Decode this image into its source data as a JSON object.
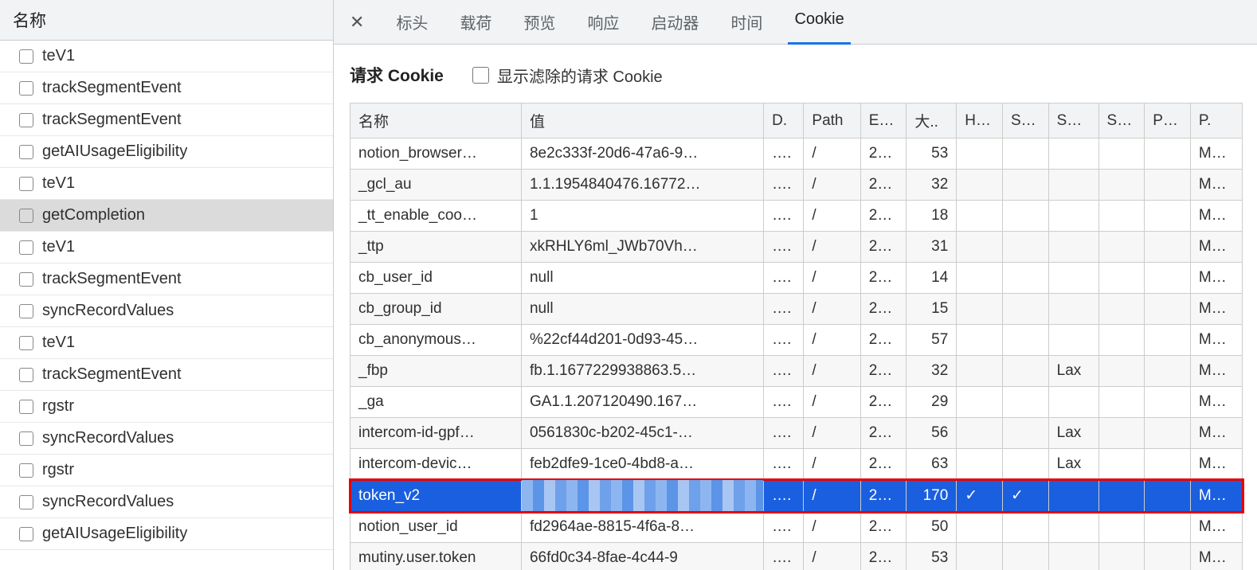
{
  "left": {
    "header": "名称",
    "items": [
      "teV1",
      "trackSegmentEvent",
      "trackSegmentEvent",
      "getAIUsageEligibility",
      "teV1",
      "getCompletion",
      "teV1",
      "trackSegmentEvent",
      "syncRecordValues",
      "teV1",
      "trackSegmentEvent",
      "rgstr",
      "syncRecordValues",
      "rgstr",
      "syncRecordValues",
      "getAIUsageEligibility"
    ],
    "selected_index": 5
  },
  "tabs": {
    "labels": [
      "标头",
      "载荷",
      "预览",
      "响应",
      "启动器",
      "时间",
      "Cookie"
    ],
    "active_index": 6
  },
  "section": {
    "title": "请求 Cookie",
    "filter_label": "显示滤除的请求 Cookie"
  },
  "cookie_headers": [
    "名称",
    "值",
    "D.",
    "Path",
    "E…",
    "大..",
    "H…",
    "S…",
    "S…",
    "S…",
    "P…",
    "P."
  ],
  "cookies": [
    {
      "name": "notion_browser…",
      "value": "8e2c333f-20d6-47a6-9…",
      "d": "….",
      "path": "/",
      "e": "2…",
      "size": "53",
      "h": "",
      "s1": "",
      "s2": "",
      "s3": "",
      "p1": "",
      "p2": "M…"
    },
    {
      "name": "_gcl_au",
      "value": "1.1.1954840476.16772…",
      "d": "….",
      "path": "/",
      "e": "2…",
      "size": "32",
      "h": "",
      "s1": "",
      "s2": "",
      "s3": "",
      "p1": "",
      "p2": "M…"
    },
    {
      "name": "_tt_enable_coo…",
      "value": "1",
      "d": "….",
      "path": "/",
      "e": "2…",
      "size": "18",
      "h": "",
      "s1": "",
      "s2": "",
      "s3": "",
      "p1": "",
      "p2": "M…"
    },
    {
      "name": "_ttp",
      "value": "xkRHLY6ml_JWb70Vh…",
      "d": "….",
      "path": "/",
      "e": "2…",
      "size": "31",
      "h": "",
      "s1": "",
      "s2": "",
      "s3": "",
      "p1": "",
      "p2": "M…"
    },
    {
      "name": "cb_user_id",
      "value": "null",
      "d": "….",
      "path": "/",
      "e": "2…",
      "size": "14",
      "h": "",
      "s1": "",
      "s2": "",
      "s3": "",
      "p1": "",
      "p2": "M…"
    },
    {
      "name": "cb_group_id",
      "value": "null",
      "d": "….",
      "path": "/",
      "e": "2…",
      "size": "15",
      "h": "",
      "s1": "",
      "s2": "",
      "s3": "",
      "p1": "",
      "p2": "M…"
    },
    {
      "name": "cb_anonymous…",
      "value": "%22cf44d201-0d93-45…",
      "d": "….",
      "path": "/",
      "e": "2…",
      "size": "57",
      "h": "",
      "s1": "",
      "s2": "",
      "s3": "",
      "p1": "",
      "p2": "M…"
    },
    {
      "name": "_fbp",
      "value": "fb.1.1677229938863.5…",
      "d": "….",
      "path": "/",
      "e": "2…",
      "size": "32",
      "h": "",
      "s1": "",
      "s2": "Lax",
      "s3": "",
      "p1": "",
      "p2": "M…"
    },
    {
      "name": "_ga",
      "value": "GA1.1.207120490.167…",
      "d": "….",
      "path": "/",
      "e": "2…",
      "size": "29",
      "h": "",
      "s1": "",
      "s2": "",
      "s3": "",
      "p1": "",
      "p2": "M…"
    },
    {
      "name": "intercom-id-gpf…",
      "value": "0561830c-b202-45c1-…",
      "d": "….",
      "path": "/",
      "e": "2…",
      "size": "56",
      "h": "",
      "s1": "",
      "s2": "Lax",
      "s3": "",
      "p1": "",
      "p2": "M…"
    },
    {
      "name": "intercom-devic…",
      "value": "feb2dfe9-1ce0-4bd8-a…",
      "d": "….",
      "path": "/",
      "e": "2…",
      "size": "63",
      "h": "",
      "s1": "",
      "s2": "Lax",
      "s3": "",
      "p1": "",
      "p2": "M…"
    },
    {
      "name": "token_v2",
      "value": "",
      "d": "….",
      "path": "/",
      "e": "2…",
      "size": "170",
      "h": "✓",
      "s1": "✓",
      "s2": "",
      "s3": "",
      "p1": "",
      "p2": "M…",
      "selected": true,
      "outline": true,
      "pixelate_value": true
    },
    {
      "name": "notion_user_id",
      "value": "fd2964ae-8815-4f6a-8…",
      "d": "….",
      "path": "/",
      "e": "2…",
      "size": "50",
      "h": "",
      "s1": "",
      "s2": "",
      "s3": "",
      "p1": "",
      "p2": "M…"
    },
    {
      "name": "mutiny.user.token",
      "value": "66fd0c34-8fae-4c44-9",
      "d": "….",
      "path": "/",
      "e": "2…",
      "size": "53",
      "h": "",
      "s1": "",
      "s2": "",
      "s3": "",
      "p1": "",
      "p2": "M…"
    }
  ]
}
